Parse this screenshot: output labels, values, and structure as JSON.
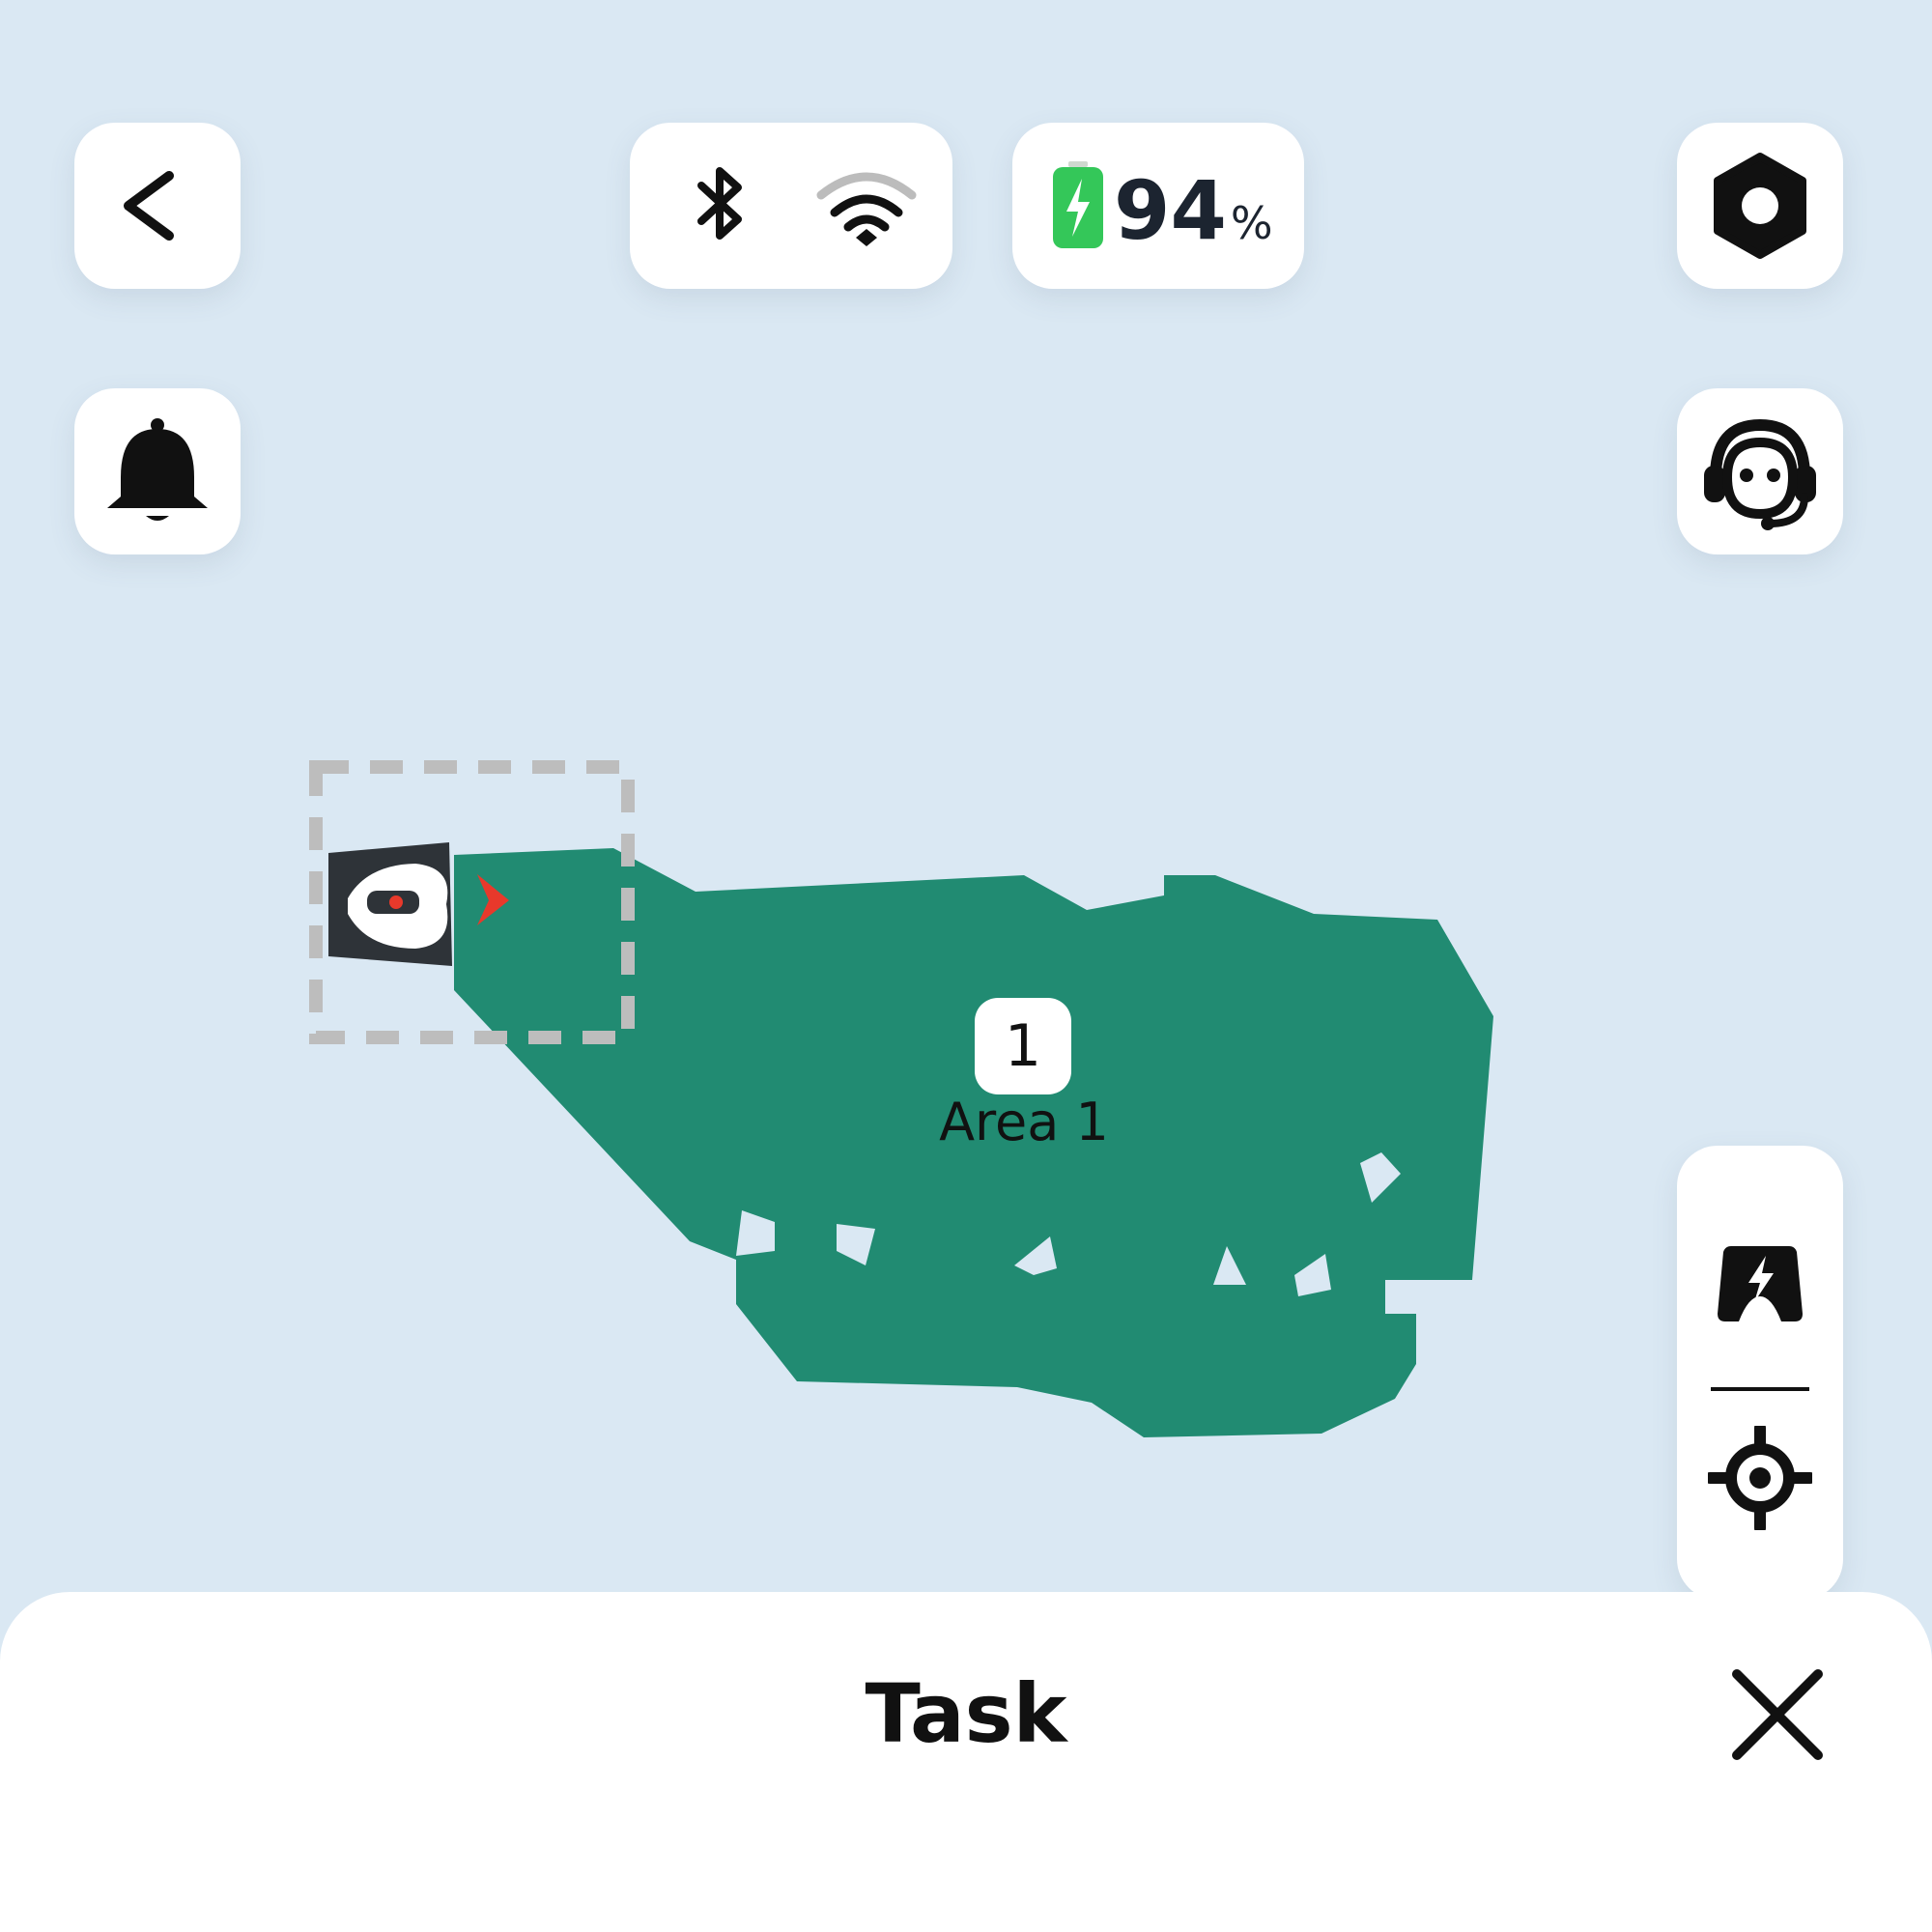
{
  "header": {
    "back_icon": "chevron-left-icon",
    "bluetooth_icon": "bluetooth-icon",
    "wifi_icon": "wifi-icon",
    "battery": {
      "level": "94",
      "unit": "%",
      "charging": true,
      "icon": "charging-battery-icon",
      "color": "#34c759"
    },
    "settings_icon": "hexagon-gear-icon"
  },
  "side_left": {
    "notification_icon": "bell-icon"
  },
  "side_right": {
    "support_icon": "headset-support-icon",
    "charging_station_icon": "charging-station-icon",
    "locate_icon": "crosshair-locate-icon"
  },
  "map": {
    "area_number": "1",
    "area_name": "Area 1",
    "lawn_color": "#218b72",
    "heading_color": "#e8392b"
  },
  "sheet": {
    "title": "Task",
    "close_icon": "close-icon"
  }
}
